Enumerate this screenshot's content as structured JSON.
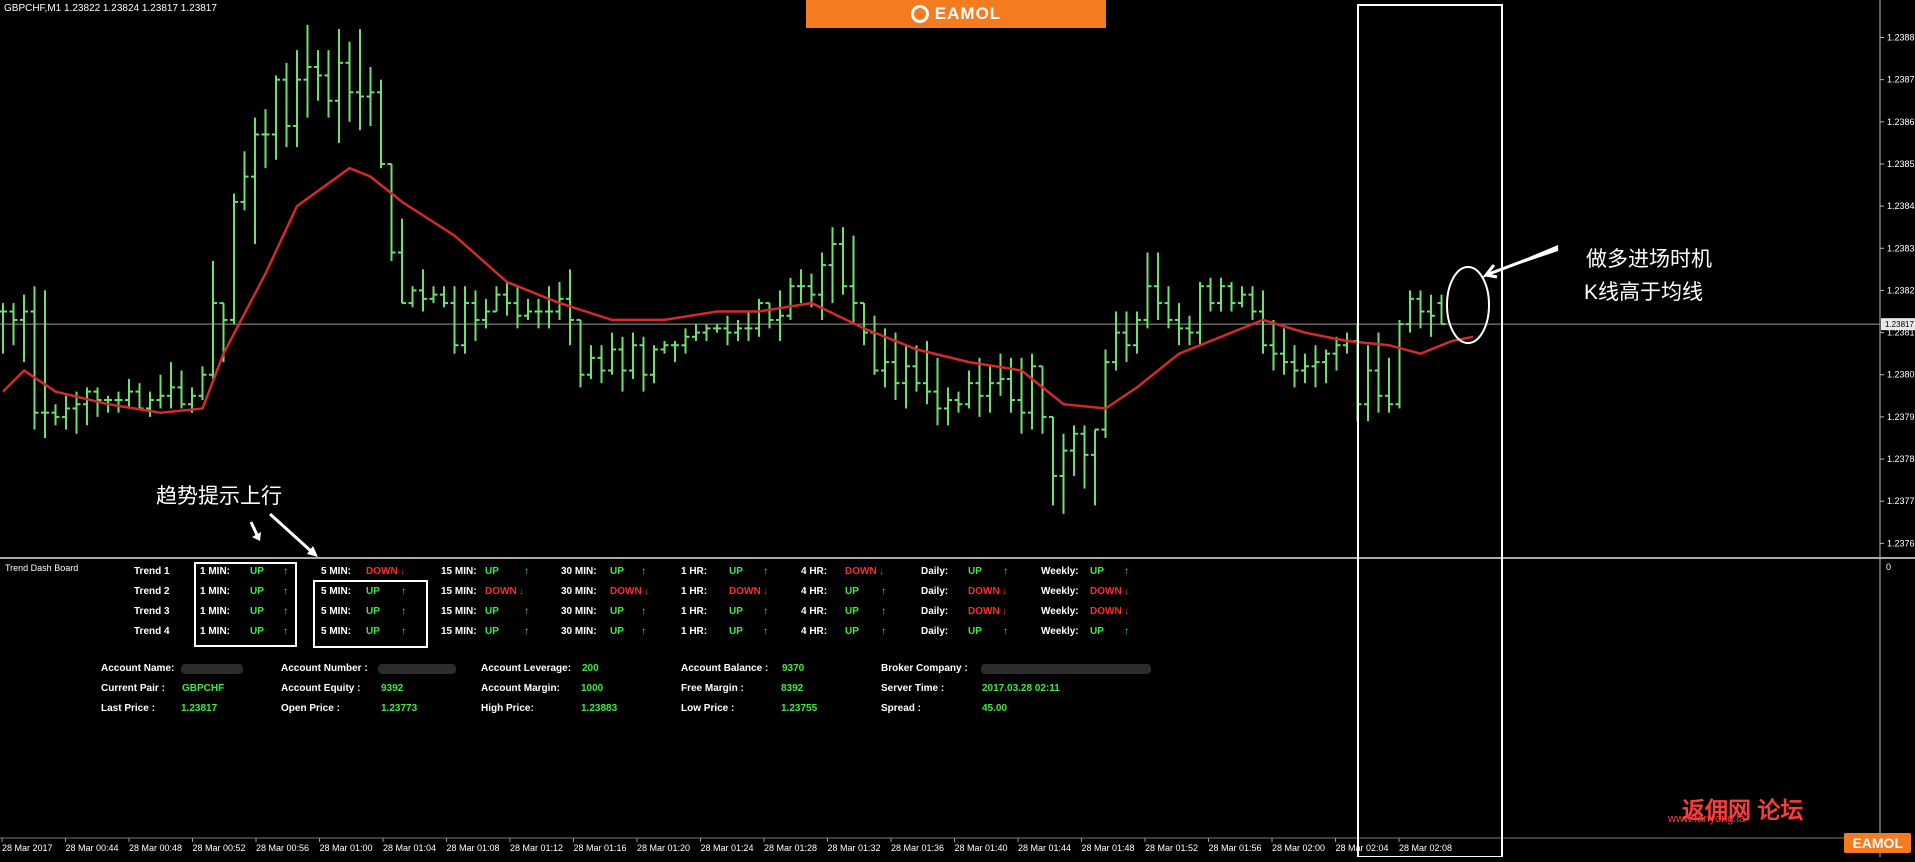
{
  "symbol_info": "GBPCHF,M1  1.23822 1.23824 1.23817 1.23817",
  "logo_text": "EAMOL",
  "price_axis": {
    "labels": [
      "1.23885",
      "1.23875",
      "1.23865",
      "1.23855",
      "1.23845",
      "1.23835",
      "1.23825",
      "1.23815",
      "1.23805",
      "1.23795",
      "1.23785",
      "1.23775",
      "1.23765"
    ],
    "current": "1.23817",
    "indicator_zero": "0"
  },
  "time_axis": [
    "28 Mar 2017",
    "28 Mar 00:44",
    "28 Mar 00:48",
    "28 Mar 00:52",
    "28 Mar 00:56",
    "28 Mar 01:00",
    "28 Mar 01:04",
    "28 Mar 01:08",
    "28 Mar 01:12",
    "28 Mar 01:16",
    "28 Mar 01:20",
    "28 Mar 01:24",
    "28 Mar 01:28",
    "28 Mar 01:32",
    "28 Mar 01:36",
    "28 Mar 01:40",
    "28 Mar 01:44",
    "28 Mar 01:48",
    "28 Mar 01:52",
    "28 Mar 01:56",
    "28 Mar 02:00",
    "28 Mar 02:04",
    "28 Mar 02:08"
  ],
  "colors": {
    "up": "#3dea3d",
    "down": "#ff2a2a",
    "ma": "#d42a2a",
    "bar": "#6fe06f",
    "accent": "#f47b20"
  },
  "annotations": {
    "trend_up": "趋势提示上行",
    "entry_line1": "做多进场时机",
    "entry_line2": "K线高于均线"
  },
  "dashboard": {
    "title": "Trend Dash Board",
    "timeframes": [
      "1 MIN:",
      "5 MIN:",
      "15 MIN:",
      "30 MIN:",
      "1 HR:",
      "4 HR:",
      "Daily:",
      "Weekly:"
    ],
    "rows": [
      {
        "name": "Trend 1",
        "values": [
          "UP",
          "DOWN",
          "UP",
          "UP",
          "UP",
          "DOWN",
          "UP",
          "UP"
        ]
      },
      {
        "name": "Trend 2",
        "values": [
          "UP",
          "UP",
          "DOWN",
          "DOWN",
          "DOWN",
          "UP",
          "DOWN",
          "DOWN"
        ]
      },
      {
        "name": "Trend 3",
        "values": [
          "UP",
          "UP",
          "UP",
          "UP",
          "UP",
          "UP",
          "DOWN",
          "DOWN"
        ]
      },
      {
        "name": "Trend 4",
        "values": [
          "UP",
          "UP",
          "UP",
          "UP",
          "UP",
          "UP",
          "UP",
          "UP"
        ]
      }
    ],
    "arrows": {
      "UP": "↑",
      "DOWN": "↓"
    }
  },
  "account": {
    "account_name_label": "Account Name:",
    "account_number_label": "Account Number :",
    "account_leverage_label": "Account Leverage:",
    "account_leverage": "200",
    "account_balance_label": "Account Balance :",
    "account_balance": "9370",
    "broker_company_label": "Broker Company :",
    "current_pair_label": "Current Pair :",
    "current_pair": "GBPCHF",
    "account_equity_label": "Account Equity :",
    "account_equity": "9392",
    "account_margin_label": "Account Margin:",
    "account_margin": "1000",
    "free_margin_label": "Free Margin :",
    "free_margin": "8392",
    "server_time_label": "Server Time :",
    "server_time": "2017.03.28 02:11",
    "last_price_label": "Last Price :",
    "last_price": "1.23817",
    "open_price_label": "Open Price :",
    "open_price": "1.23773",
    "high_price_label": "High Price:",
    "high_price": "1.23883",
    "low_price_label": "Low Price :",
    "low_price": "1.23755",
    "spread_label": "Spread :",
    "spread": "45.00"
  },
  "watermark": {
    "forum": "返佣网 论坛",
    "site": "www.fanyong.la",
    "badge": "EAMOL"
  },
  "chart_data": {
    "type": "ohlc",
    "xlabel": "",
    "ylabel": "",
    "ylim": [
      1.23762,
      1.23892
    ],
    "grid": false,
    "current_price": 1.23817,
    "bars": [
      {
        "o": 1.2382,
        "h": 1.23822,
        "l": 1.2381,
        "c": 1.2382
      },
      {
        "o": 1.2382,
        "h": 1.23822,
        "l": 1.23812,
        "c": 1.23818
      },
      {
        "o": 1.23818,
        "h": 1.23824,
        "l": 1.23808,
        "c": 1.2382
      },
      {
        "o": 1.2382,
        "h": 1.23826,
        "l": 1.23792,
        "c": 1.23796
      },
      {
        "o": 1.23796,
        "h": 1.23825,
        "l": 1.2379,
        "c": 1.23796
      },
      {
        "o": 1.23796,
        "h": 1.23798,
        "l": 1.23793,
        "c": 1.23795
      },
      {
        "o": 1.23795,
        "h": 1.238,
        "l": 1.23792,
        "c": 1.23797
      },
      {
        "o": 1.23797,
        "h": 1.23801,
        "l": 1.23791,
        "c": 1.23798
      },
      {
        "o": 1.23798,
        "h": 1.23802,
        "l": 1.23793,
        "c": 1.23801
      },
      {
        "o": 1.23801,
        "h": 1.23802,
        "l": 1.23795,
        "c": 1.23799
      },
      {
        "o": 1.23799,
        "h": 1.238,
        "l": 1.23796,
        "c": 1.23799
      },
      {
        "o": 1.23799,
        "h": 1.23801,
        "l": 1.23796,
        "c": 1.23799
      },
      {
        "o": 1.23799,
        "h": 1.23804,
        "l": 1.23797,
        "c": 1.23801
      },
      {
        "o": 1.23801,
        "h": 1.23803,
        "l": 1.23797,
        "c": 1.23797
      },
      {
        "o": 1.23797,
        "h": 1.23801,
        "l": 1.23795,
        "c": 1.23799
      },
      {
        "o": 1.23799,
        "h": 1.23805,
        "l": 1.23797,
        "c": 1.238
      },
      {
        "o": 1.238,
        "h": 1.23808,
        "l": 1.23797,
        "c": 1.23802
      },
      {
        "o": 1.23802,
        "h": 1.23806,
        "l": 1.23797,
        "c": 1.23798
      },
      {
        "o": 1.23798,
        "h": 1.23802,
        "l": 1.23796,
        "c": 1.238
      },
      {
        "o": 1.238,
        "h": 1.23807,
        "l": 1.23799,
        "c": 1.23805
      },
      {
        "o": 1.23805,
        "h": 1.23832,
        "l": 1.23804,
        "c": 1.23822
      },
      {
        "o": 1.23822,
        "h": 1.23822,
        "l": 1.23808,
        "c": 1.23818
      },
      {
        "o": 1.23818,
        "h": 1.23848,
        "l": 1.23817,
        "c": 1.23846
      },
      {
        "o": 1.23846,
        "h": 1.23858,
        "l": 1.23844,
        "c": 1.23852
      },
      {
        "o": 1.23852,
        "h": 1.23866,
        "l": 1.23836,
        "c": 1.23862
      },
      {
        "o": 1.23862,
        "h": 1.23868,
        "l": 1.23854,
        "c": 1.23862
      },
      {
        "o": 1.23862,
        "h": 1.23876,
        "l": 1.23856,
        "c": 1.23875
      },
      {
        "o": 1.23875,
        "h": 1.23879,
        "l": 1.23859,
        "c": 1.23864
      },
      {
        "o": 1.23864,
        "h": 1.23882,
        "l": 1.23859,
        "c": 1.23875
      },
      {
        "o": 1.23875,
        "h": 1.23888,
        "l": 1.23866,
        "c": 1.23878
      },
      {
        "o": 1.23878,
        "h": 1.23882,
        "l": 1.2387,
        "c": 1.23876
      },
      {
        "o": 1.23876,
        "h": 1.23882,
        "l": 1.23866,
        "c": 1.2387
      },
      {
        "o": 1.2387,
        "h": 1.23887,
        "l": 1.2386,
        "c": 1.23879
      },
      {
        "o": 1.23879,
        "h": 1.23884,
        "l": 1.23865,
        "c": 1.23872
      },
      {
        "o": 1.23872,
        "h": 1.23887,
        "l": 1.23863,
        "c": 1.23871
      },
      {
        "o": 1.23871,
        "h": 1.23878,
        "l": 1.23864,
        "c": 1.23872
      },
      {
        "o": 1.23872,
        "h": 1.23875,
        "l": 1.23854,
        "c": 1.23855
      },
      {
        "o": 1.23855,
        "h": 1.23855,
        "l": 1.23832,
        "c": 1.23834
      },
      {
        "o": 1.23834,
        "h": 1.23842,
        "l": 1.23822,
        "c": 1.23822
      },
      {
        "o": 1.23822,
        "h": 1.23826,
        "l": 1.23821,
        "c": 1.23825
      },
      {
        "o": 1.23825,
        "h": 1.2383,
        "l": 1.2382,
        "c": 1.23823
      },
      {
        "o": 1.23823,
        "h": 1.23826,
        "l": 1.23822,
        "c": 1.23824
      },
      {
        "o": 1.23824,
        "h": 1.23826,
        "l": 1.23821,
        "c": 1.23822
      },
      {
        "o": 1.23822,
        "h": 1.23826,
        "l": 1.2381,
        "c": 1.23812
      },
      {
        "o": 1.23812,
        "h": 1.23826,
        "l": 1.2381,
        "c": 1.23822
      },
      {
        "o": 1.23822,
        "h": 1.23825,
        "l": 1.23813,
        "c": 1.23818
      },
      {
        "o": 1.23818,
        "h": 1.23823,
        "l": 1.23816,
        "c": 1.2382
      },
      {
        "o": 1.2382,
        "h": 1.23826,
        "l": 1.2382,
        "c": 1.23824
      },
      {
        "o": 1.23824,
        "h": 1.23827,
        "l": 1.23819,
        "c": 1.23822
      },
      {
        "o": 1.23822,
        "h": 1.23826,
        "l": 1.23816,
        "c": 1.23819
      },
      {
        "o": 1.23819,
        "h": 1.23823,
        "l": 1.23818,
        "c": 1.2382
      },
      {
        "o": 1.2382,
        "h": 1.23823,
        "l": 1.23816,
        "c": 1.2382
      },
      {
        "o": 1.2382,
        "h": 1.23826,
        "l": 1.23816,
        "c": 1.2382
      },
      {
        "o": 1.2382,
        "h": 1.23827,
        "l": 1.23818,
        "c": 1.23823
      },
      {
        "o": 1.23823,
        "h": 1.2383,
        "l": 1.23812,
        "c": 1.23818
      },
      {
        "o": 1.23818,
        "h": 1.23818,
        "l": 1.23802,
        "c": 1.23805
      },
      {
        "o": 1.23805,
        "h": 1.23812,
        "l": 1.23804,
        "c": 1.23809
      },
      {
        "o": 1.23809,
        "h": 1.23812,
        "l": 1.23803,
        "c": 1.23806
      },
      {
        "o": 1.23806,
        "h": 1.23815,
        "l": 1.23805,
        "c": 1.23811
      },
      {
        "o": 1.23811,
        "h": 1.23814,
        "l": 1.23801,
        "c": 1.23806
      },
      {
        "o": 1.23806,
        "h": 1.23815,
        "l": 1.23804,
        "c": 1.23812
      },
      {
        "o": 1.23812,
        "h": 1.23814,
        "l": 1.23801,
        "c": 1.23805
      },
      {
        "o": 1.23805,
        "h": 1.23812,
        "l": 1.23803,
        "c": 1.23811
      },
      {
        "o": 1.23811,
        "h": 1.23813,
        "l": 1.2381,
        "c": 1.23812
      },
      {
        "o": 1.23812,
        "h": 1.23813,
        "l": 1.23808,
        "c": 1.23812
      },
      {
        "o": 1.23812,
        "h": 1.23816,
        "l": 1.2381,
        "c": 1.23814
      },
      {
        "o": 1.23814,
        "h": 1.23817,
        "l": 1.23813,
        "c": 1.23815
      },
      {
        "o": 1.23815,
        "h": 1.23817,
        "l": 1.23813,
        "c": 1.23816
      },
      {
        "o": 1.23816,
        "h": 1.23817,
        "l": 1.23815,
        "c": 1.23816
      },
      {
        "o": 1.23816,
        "h": 1.23819,
        "l": 1.23812,
        "c": 1.23815
      },
      {
        "o": 1.23815,
        "h": 1.23818,
        "l": 1.23813,
        "c": 1.23816
      },
      {
        "o": 1.23816,
        "h": 1.2382,
        "l": 1.23813,
        "c": 1.23816
      },
      {
        "o": 1.23816,
        "h": 1.23823,
        "l": 1.23814,
        "c": 1.23822
      },
      {
        "o": 1.23822,
        "h": 1.23822,
        "l": 1.23816,
        "c": 1.23818
      },
      {
        "o": 1.23818,
        "h": 1.23825,
        "l": 1.23813,
        "c": 1.23819
      },
      {
        "o": 1.23819,
        "h": 1.23828,
        "l": 1.23818,
        "c": 1.23826
      },
      {
        "o": 1.23826,
        "h": 1.2383,
        "l": 1.23822,
        "c": 1.23826
      },
      {
        "o": 1.23826,
        "h": 1.23829,
        "l": 1.23821,
        "c": 1.23824
      },
      {
        "o": 1.23824,
        "h": 1.23834,
        "l": 1.23818,
        "c": 1.23831
      },
      {
        "o": 1.23831,
        "h": 1.2384,
        "l": 1.23822,
        "c": 1.23836
      },
      {
        "o": 1.23836,
        "h": 1.2384,
        "l": 1.23824,
        "c": 1.23826
      },
      {
        "o": 1.23826,
        "h": 1.23838,
        "l": 1.23817,
        "c": 1.23822
      },
      {
        "o": 1.23822,
        "h": 1.23822,
        "l": 1.23812,
        "c": 1.23815
      },
      {
        "o": 1.23815,
        "h": 1.23819,
        "l": 1.23805,
        "c": 1.23806
      },
      {
        "o": 1.23806,
        "h": 1.23816,
        "l": 1.23802,
        "c": 1.23808
      },
      {
        "o": 1.23808,
        "h": 1.23815,
        "l": 1.23799,
        "c": 1.23803
      },
      {
        "o": 1.23803,
        "h": 1.23812,
        "l": 1.23797,
        "c": 1.23807
      },
      {
        "o": 1.23807,
        "h": 1.23812,
        "l": 1.23801,
        "c": 1.23803
      },
      {
        "o": 1.23803,
        "h": 1.23813,
        "l": 1.23798,
        "c": 1.23801
      },
      {
        "o": 1.23801,
        "h": 1.23809,
        "l": 1.23793,
        "c": 1.23797
      },
      {
        "o": 1.23797,
        "h": 1.23802,
        "l": 1.23793,
        "c": 1.23799
      },
      {
        "o": 1.23799,
        "h": 1.23801,
        "l": 1.23796,
        "c": 1.23798
      },
      {
        "o": 1.23798,
        "h": 1.23806,
        "l": 1.23797,
        "c": 1.23803
      },
      {
        "o": 1.23803,
        "h": 1.23809,
        "l": 1.23795,
        "c": 1.238
      },
      {
        "o": 1.238,
        "h": 1.23807,
        "l": 1.23796,
        "c": 1.23803
      },
      {
        "o": 1.23803,
        "h": 1.2381,
        "l": 1.238,
        "c": 1.23804
      },
      {
        "o": 1.23804,
        "h": 1.23809,
        "l": 1.23796,
        "c": 1.23799
      },
      {
        "o": 1.23799,
        "h": 1.23809,
        "l": 1.23791,
        "c": 1.23796
      },
      {
        "o": 1.23796,
        "h": 1.2381,
        "l": 1.23792,
        "c": 1.23807
      },
      {
        "o": 1.23807,
        "h": 1.23807,
        "l": 1.23791,
        "c": 1.23795
      },
      {
        "o": 1.23795,
        "h": 1.23795,
        "l": 1.23774,
        "c": 1.23781
      },
      {
        "o": 1.23781,
        "h": 1.23791,
        "l": 1.23772,
        "c": 1.23787
      },
      {
        "o": 1.23787,
        "h": 1.23793,
        "l": 1.23781,
        "c": 1.23791
      },
      {
        "o": 1.23791,
        "h": 1.23793,
        "l": 1.23778,
        "c": 1.23786
      },
      {
        "o": 1.23786,
        "h": 1.23792,
        "l": 1.23774,
        "c": 1.23792
      },
      {
        "o": 1.23792,
        "h": 1.23811,
        "l": 1.2379,
        "c": 1.23808
      },
      {
        "o": 1.23808,
        "h": 1.2382,
        "l": 1.23806,
        "c": 1.23815
      },
      {
        "o": 1.23815,
        "h": 1.2382,
        "l": 1.23808,
        "c": 1.23812
      },
      {
        "o": 1.23812,
        "h": 1.2382,
        "l": 1.2381,
        "c": 1.23818
      },
      {
        "o": 1.23818,
        "h": 1.23834,
        "l": 1.23816,
        "c": 1.23826
      },
      {
        "o": 1.23826,
        "h": 1.23834,
        "l": 1.23818,
        "c": 1.23822
      },
      {
        "o": 1.23822,
        "h": 1.23826,
        "l": 1.23816,
        "c": 1.23818
      },
      {
        "o": 1.23818,
        "h": 1.23822,
        "l": 1.23812,
        "c": 1.23816
      },
      {
        "o": 1.23816,
        "h": 1.23819,
        "l": 1.23812,
        "c": 1.23815
      },
      {
        "o": 1.23815,
        "h": 1.23827,
        "l": 1.23812,
        "c": 1.23826
      },
      {
        "o": 1.23826,
        "h": 1.23828,
        "l": 1.2382,
        "c": 1.23822
      },
      {
        "o": 1.23822,
        "h": 1.23828,
        "l": 1.2382,
        "c": 1.23826
      },
      {
        "o": 1.23826,
        "h": 1.23827,
        "l": 1.2382,
        "c": 1.23822
      },
      {
        "o": 1.23822,
        "h": 1.23826,
        "l": 1.23821,
        "c": 1.23824
      },
      {
        "o": 1.23824,
        "h": 1.23826,
        "l": 1.23818,
        "c": 1.2382
      },
      {
        "o": 1.2382,
        "h": 1.23825,
        "l": 1.2381,
        "c": 1.23812
      },
      {
        "o": 1.23812,
        "h": 1.23818,
        "l": 1.23806,
        "c": 1.2381
      },
      {
        "o": 1.2381,
        "h": 1.23816,
        "l": 1.23805,
        "c": 1.23808
      },
      {
        "o": 1.23808,
        "h": 1.23812,
        "l": 1.23802,
        "c": 1.23806
      },
      {
        "o": 1.23806,
        "h": 1.2381,
        "l": 1.23803,
        "c": 1.23807
      },
      {
        "o": 1.23807,
        "h": 1.23812,
        "l": 1.23802,
        "c": 1.23808
      },
      {
        "o": 1.23808,
        "h": 1.23811,
        "l": 1.23803,
        "c": 1.2381
      },
      {
        "o": 1.2381,
        "h": 1.23814,
        "l": 1.23806,
        "c": 1.23812
      },
      {
        "o": 1.23812,
        "h": 1.23815,
        "l": 1.2381,
        "c": 1.23813
      },
      {
        "o": 1.23813,
        "h": 1.23817,
        "l": 1.23794,
        "c": 1.23798
      },
      {
        "o": 1.23798,
        "h": 1.23812,
        "l": 1.23794,
        "c": 1.23806
      },
      {
        "o": 1.23806,
        "h": 1.23815,
        "l": 1.23796,
        "c": 1.238
      },
      {
        "o": 1.238,
        "h": 1.23809,
        "l": 1.23796,
        "c": 1.23798
      },
      {
        "o": 1.23798,
        "h": 1.23818,
        "l": 1.23797,
        "c": 1.23817
      },
      {
        "o": 1.23817,
        "h": 1.23825,
        "l": 1.23815,
        "c": 1.23823
      },
      {
        "o": 1.23823,
        "h": 1.23825,
        "l": 1.23816,
        "c": 1.2382
      },
      {
        "o": 1.2382,
        "h": 1.23824,
        "l": 1.23814,
        "c": 1.23819
      },
      {
        "o": 1.23822,
        "h": 1.23824,
        "l": 1.23817,
        "c": 1.23817
      }
    ],
    "ma_series": {
      "x_index": [
        0,
        2,
        5,
        10,
        15,
        19,
        21,
        25,
        28,
        33,
        35,
        38,
        43,
        48,
        53,
        58,
        63,
        68,
        72,
        77,
        82,
        87,
        92,
        97,
        101,
        105,
        108,
        112,
        116,
        120,
        124,
        128,
        132,
        135,
        138,
        140
      ],
      "values": [
        1.23801,
        1.23806,
        1.23801,
        1.23798,
        1.23796,
        1.23797,
        1.2381,
        1.23829,
        1.23845,
        1.23854,
        1.23852,
        1.23846,
        1.23838,
        1.23827,
        1.23822,
        1.23818,
        1.23818,
        1.2382,
        1.2382,
        1.23822,
        1.23816,
        1.23811,
        1.23808,
        1.23806,
        1.23798,
        1.23797,
        1.23802,
        1.2381,
        1.23814,
        1.23818,
        1.23815,
        1.23813,
        1.23812,
        1.2381,
        1.23813,
        1.23814
      ]
    }
  }
}
